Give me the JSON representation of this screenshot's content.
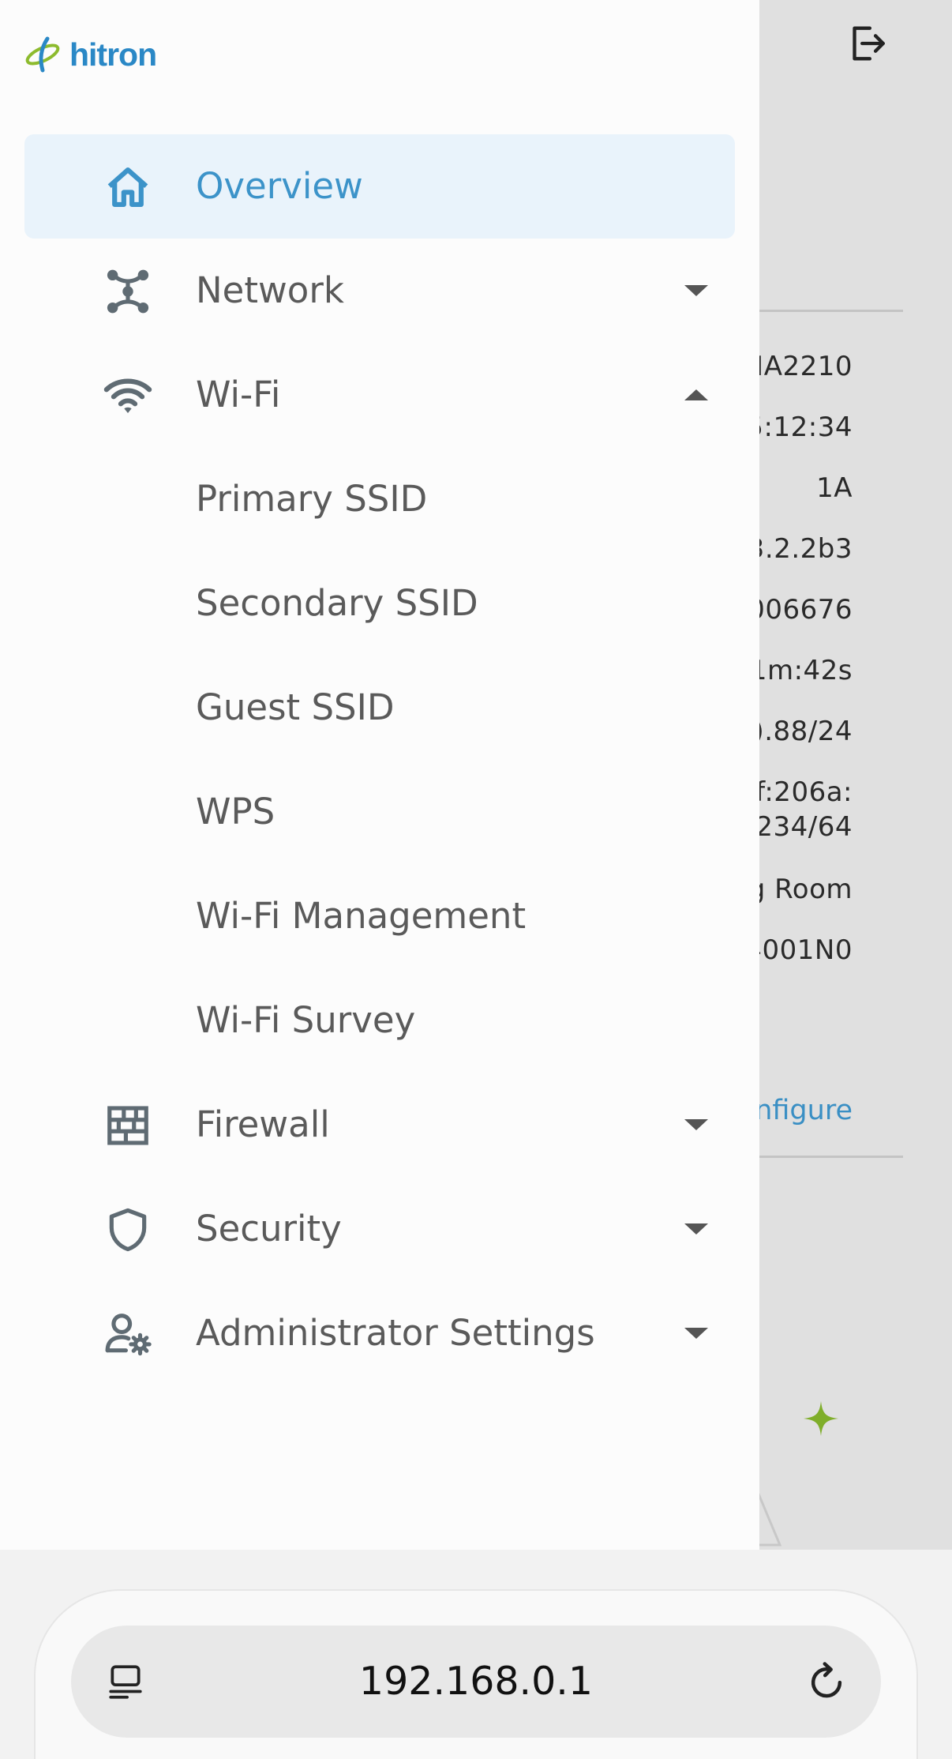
{
  "background": {
    "rows": [
      "IA2210",
      "5:12:34",
      "1A",
      "3.2.2b3",
      "006676",
      "1m:42s",
      ").88/24",
      "f:206a:",
      "234/64",
      "g Room",
      "4001N0"
    ],
    "configure_link": "nfigure",
    "logout_icon": "logout-icon",
    "sparkle_icon": "sparkle-icon"
  },
  "drawer": {
    "logo_text": "hitron",
    "items": [
      {
        "label": "Overview",
        "icon": "home-icon",
        "active": true
      },
      {
        "label": "Network",
        "icon": "network-icon",
        "expand": "down"
      },
      {
        "label": "Wi-Fi",
        "icon": "wifi-icon",
        "expand": "up"
      },
      {
        "label": "Primary SSID"
      },
      {
        "label": "Secondary SSID"
      },
      {
        "label": "Guest SSID"
      },
      {
        "label": "WPS"
      },
      {
        "label": "Wi-Fi Management"
      },
      {
        "label": "Wi-Fi Survey"
      },
      {
        "label": "Firewall",
        "icon": "firewall-icon",
        "expand": "down"
      },
      {
        "label": "Security",
        "icon": "shield-icon",
        "expand": "down"
      },
      {
        "label": "Administrator Settings",
        "icon": "admin-settings-icon",
        "expand": "down"
      }
    ]
  },
  "browser": {
    "url": "192.168.0.1",
    "page_icon": "page-settings-icon",
    "reload_icon": "reload-icon"
  },
  "colors": {
    "accent": "#3c93c9",
    "active_bg": "#e9f3fb",
    "text": "#5a5a5a",
    "logo_blue": "#2a88c6",
    "logo_green": "#8dbb2e"
  }
}
